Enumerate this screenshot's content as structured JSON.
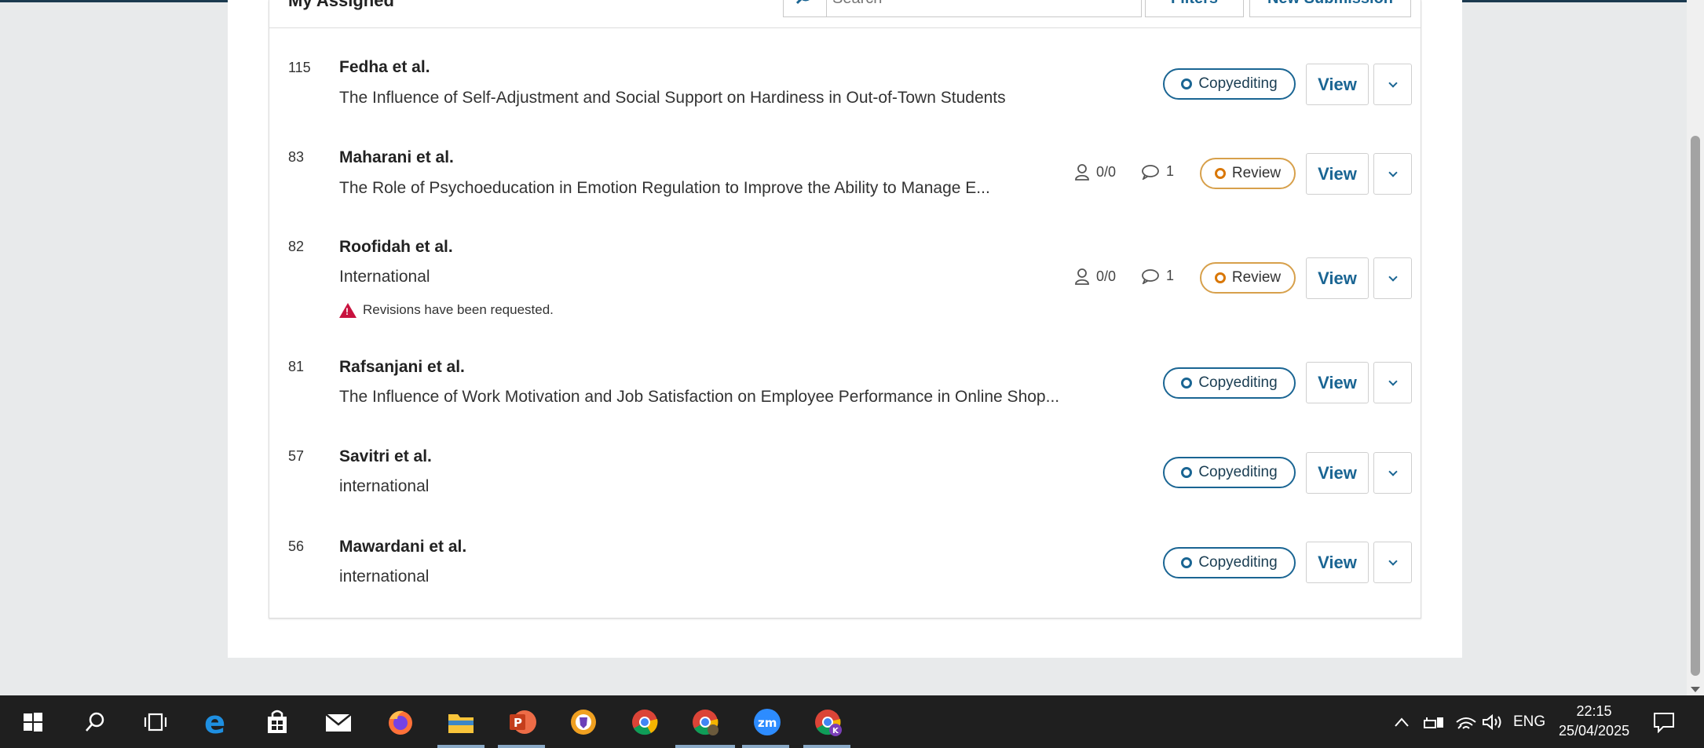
{
  "header": {
    "title": "My Assigned",
    "search_placeholder": "Search",
    "filters_label": "Filters",
    "new_submission_label": "New Submission"
  },
  "submissions": [
    {
      "id": "115",
      "author": "Fedha et al.",
      "title": "The Influence of Self-Adjustment and Social Support on Hardiness in Out-of-Town Students",
      "stage": "Copyediting",
      "view": "View"
    },
    {
      "id": "83",
      "author": "Maharani et al.",
      "title": "The Role of Psychoeducation in Emotion Regulation to Improve the Ability to Manage E...",
      "stage": "Review",
      "reviews": "0/0",
      "discussions": "1",
      "view": "View"
    },
    {
      "id": "82",
      "author": "Roofidah et al.",
      "title": "International",
      "stage": "Review",
      "reviews": "0/0",
      "discussions": "1",
      "notice": "Revisions have been requested.",
      "view": "View"
    },
    {
      "id": "81",
      "author": "Rafsanjani et al.",
      "title": "The Influence of Work Motivation and Job Satisfaction on Employee Performance in Online Shop...",
      "stage": "Copyediting",
      "view": "View"
    },
    {
      "id": "57",
      "author": "Savitri et al.",
      "title": "international",
      "stage": "Copyediting",
      "view": "View"
    },
    {
      "id": "56",
      "author": "Mawardani et al.",
      "title": "international",
      "stage": "Copyediting",
      "view": "View"
    }
  ],
  "taskbar": {
    "language": "ENG",
    "time": "22:15",
    "date": "25/04/2025",
    "app_icons": [
      "windows-start-icon",
      "search-icon",
      "task-view-icon",
      "edge-icon",
      "store-icon",
      "mail-icon",
      "firefox-icon",
      "file-explorer-icon",
      "powerpoint-icon",
      "brave-icon",
      "chrome-icon",
      "chrome-profile-icon",
      "zoom-icon",
      "chrome-k-profile-icon"
    ]
  },
  "colors": {
    "accent": "#1a6593",
    "review": "#d7a04b",
    "warning": "#c8123e"
  }
}
